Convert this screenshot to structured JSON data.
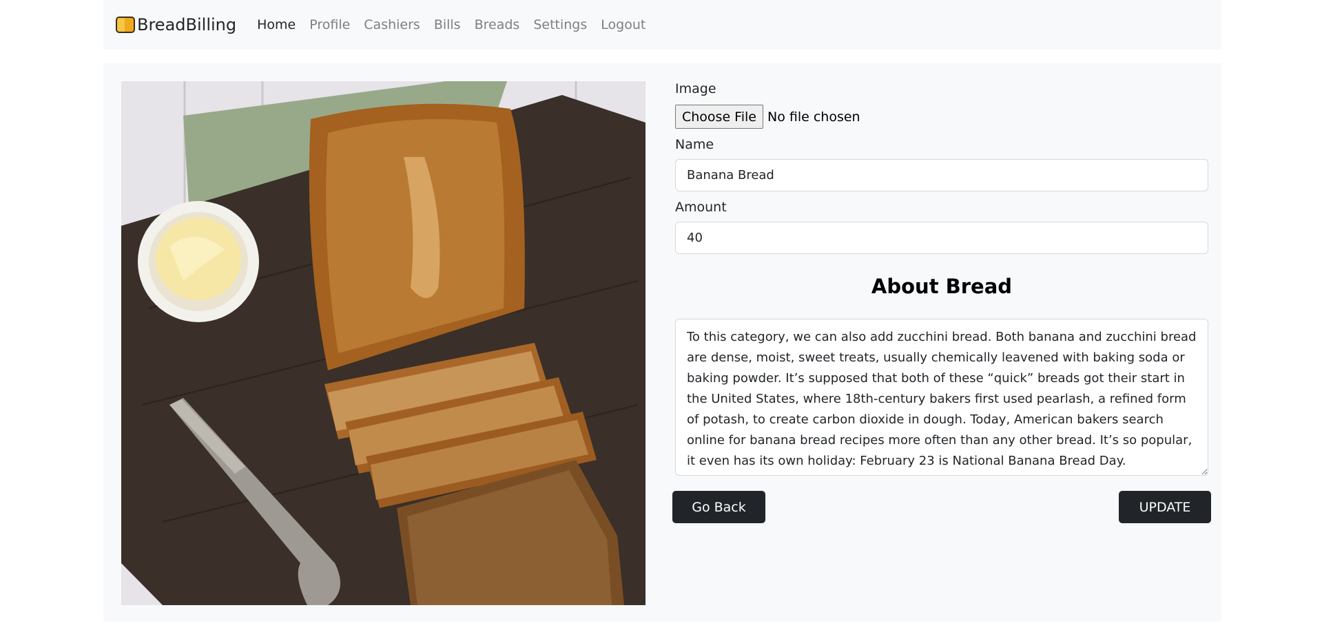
{
  "brand": {
    "name": "BreadBilling",
    "icon": "bread-icon"
  },
  "nav": {
    "items": [
      {
        "label": "Home",
        "active": true
      },
      {
        "label": "Profile",
        "active": false
      },
      {
        "label": "Cashiers",
        "active": false
      },
      {
        "label": "Bills",
        "active": false
      },
      {
        "label": "Breads",
        "active": false
      },
      {
        "label": "Settings",
        "active": false
      },
      {
        "label": "Logout",
        "active": false
      }
    ]
  },
  "form": {
    "image_label": "Image",
    "file_button": "Choose File",
    "file_status": "No file chosen",
    "name_label": "Name",
    "name_value": "Banana Bread",
    "amount_label": "Amount",
    "amount_value": "40",
    "about_heading": "About Bread",
    "about_text": "To this category, we can also add zucchini bread. Both banana and zucchini bread are dense, moist, sweet treats, usually chemically leavened with baking soda or baking powder. It’s supposed that both of these “quick” breads got their start in the United States, where 18th-century bakers first used pearlash, a refined form of potash, to create carbon dioxide in dough. Today, American bakers search online for banana bread recipes more often than any other bread. It’s so popular, it even has its own holiday: February 23 is National Banana Bread Day.",
    "back_label": "Go Back",
    "update_label": "UPDATE"
  },
  "colors": {
    "navbar_bg": "#f8f9fa",
    "button_bg": "#212529",
    "nav_muted": "#7d7f82"
  }
}
